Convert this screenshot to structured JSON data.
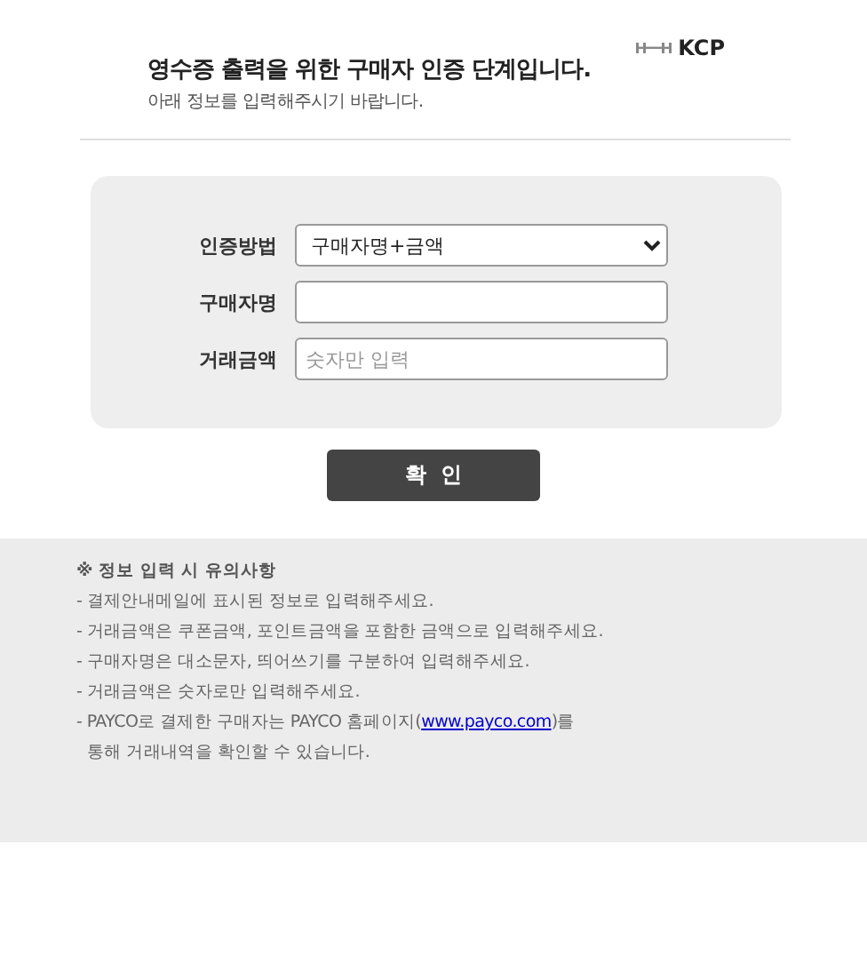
{
  "header": {
    "logo": "KCP",
    "title": "영수증 출력을 위한 구매자 인증 단계입니다.",
    "subtitle": "아래 정보를 입력해주시기 바랍니다."
  },
  "form": {
    "fields": [
      {
        "label": "인증방법",
        "kind": "select",
        "value": "구매자명+금액"
      },
      {
        "label": "구매자명",
        "kind": "text"
      },
      {
        "label": "거래금액",
        "kind": "text",
        "placeholder": "숫자만 입력"
      }
    ]
  },
  "confirm_button": "확  인",
  "notes": {
    "title": "※ 정보 입력 시 유의사항",
    "items": [
      {
        "text": "- 결제안내메일에 표시된 정보로 입력해주세요."
      },
      {
        "text": "- 거래금액은 쿠폰금액, 포인트금액을 포함한 금액으로 입력해주세요."
      },
      {
        "text": "- 구매자명은 대소문자, 띄어쓰기를 구분하여 입력해주세요."
      },
      {
        "text": "- 거래금액은 숫자로만 입력해주세요."
      },
      {
        "text": "- PAYCO로 결제한 구매자는 PAYCO 홈페이지(",
        "link": "www.payco.com",
        "text_after": ")를",
        "continuation": "통해 거래내역을 확인할 수 있습니다."
      }
    ]
  }
}
